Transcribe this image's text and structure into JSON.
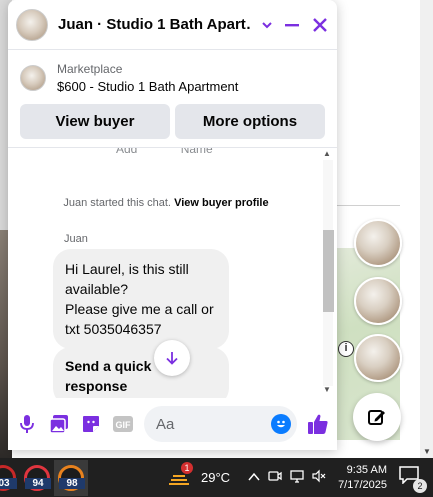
{
  "chat": {
    "title": "Juan · Studio 1 Bath Apart…",
    "listing": {
      "source": "Marketplace",
      "title": "$600 - Studio 1 Bath Apartment"
    },
    "buttons": {
      "view_buyer": "View buyer",
      "more_options": "More options"
    },
    "cutoff_labels": [
      "Add",
      "Name"
    ],
    "system_message": {
      "prefix": "Juan started this chat.",
      "link": "View buyer profile"
    },
    "sender_name": "Juan",
    "messages": [
      "Hi Laurel, is this still available?\nPlease give me a call or txt 5035046357",
      "Send a quick response"
    ],
    "composer": {
      "placeholder": "Aa"
    },
    "accent_color": "#7b2fe0",
    "icons": [
      "microphone-icon",
      "photo-icon",
      "sticker-icon",
      "gif-icon",
      "emoji-icon",
      "thumbs-up-icon",
      "minimize-icon",
      "close-icon",
      "chevron-down-icon",
      "arrow-down-icon"
    ]
  },
  "taskbar": {
    "apps": [
      {
        "name": "app-1",
        "label": "03"
      },
      {
        "name": "app-2",
        "label": "94"
      },
      {
        "name": "app-3",
        "label": "98"
      }
    ],
    "weather": {
      "temperature": "29°C",
      "alert_count": "1"
    },
    "clock": {
      "time": "9:35 AM",
      "date": "7/17/2025"
    },
    "notifications_count": "2"
  }
}
